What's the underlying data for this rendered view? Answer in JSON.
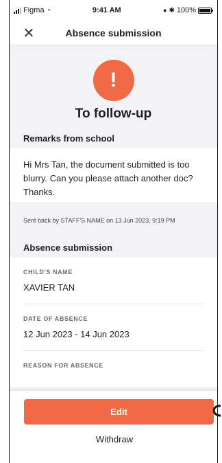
{
  "status_bar": {
    "carrier": "Figma",
    "time": "9:41 AM",
    "battery": "100%",
    "battery_level": 1.0
  },
  "header": {
    "title": "Absence submission",
    "close_icon": "close-icon"
  },
  "status": {
    "icon": "alert-icon",
    "icon_glyph": "!",
    "title": "To follow-up",
    "accent_color": "#ef6a45"
  },
  "remarks": {
    "heading": "Remarks from school",
    "message": "Hi Mrs Tan, the document submitted is too blurry. Can you please attach another doc? Thanks.",
    "sent_back": "Sent back by STAFF'S NAME on 13 Jun 2023, 9:19 PM"
  },
  "submission": {
    "heading": "Absence submission",
    "fields": [
      {
        "label": "CHILD'S NAME",
        "value": "XAVIER TAN"
      },
      {
        "label": "DATE OF ABSENCE",
        "value": "12 Jun 2023 - 14 Jun 2023"
      },
      {
        "label": "REASON FOR ABSENCE",
        "value": ""
      }
    ]
  },
  "actions": {
    "edit_label": "Edit",
    "withdraw_label": "Withdraw"
  }
}
